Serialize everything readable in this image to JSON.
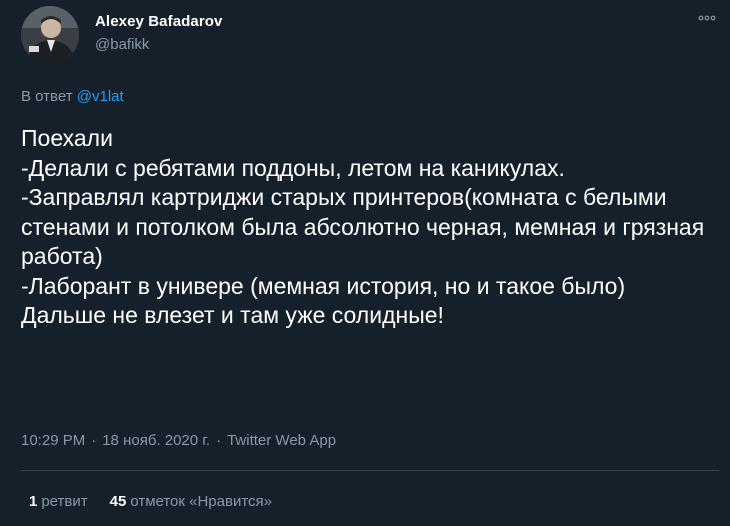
{
  "author": {
    "name": "Alexey Bafadarov",
    "handle": "@bafikk"
  },
  "reply": {
    "prefix": "В ответ",
    "to": "@v1lat"
  },
  "tweet": {
    "text": "Поехали\n-Делали с ребятами поддоны, летом на каникулах.\n-Заправлял картриджи старых принтеров(комната с белыми стенами и потолком была абсолютно черная, мемная и грязная работа)\n-Лаборант в универе (мемная история, но и такое было)\nДальше не влезет и там уже солидные!"
  },
  "meta": {
    "time": "10:29 PM",
    "date": "18 нояб. 2020 г.",
    "source": "Twitter Web App",
    "separator": "·"
  },
  "stats": {
    "retweets_count": "1",
    "retweets_label": "ретвит",
    "likes_count": "45",
    "likes_label": "отметок «Нравится»"
  },
  "icons": {
    "more": "more-horizontal-icon"
  },
  "colors": {
    "background": "#15202b",
    "text": "#ffffff",
    "secondary": "#8899a6",
    "link": "#1da1f2",
    "divider": "#38444d"
  }
}
